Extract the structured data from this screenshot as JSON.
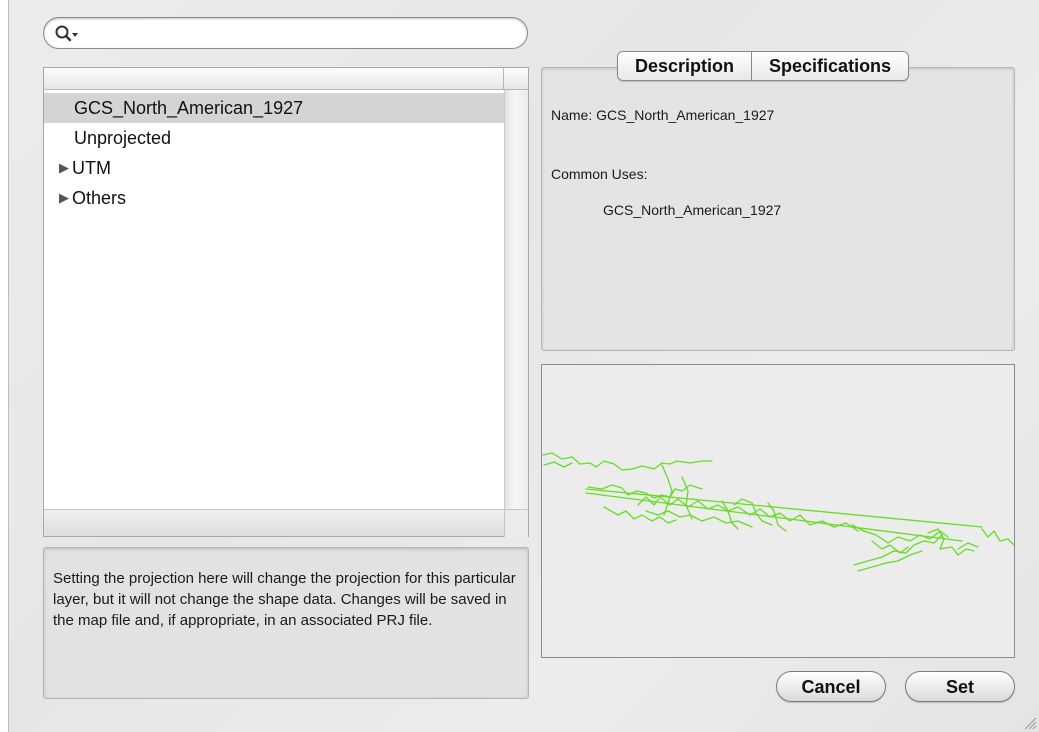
{
  "search": {
    "value": "",
    "placeholder": ""
  },
  "projection_list": {
    "items": [
      {
        "label": "GCS_North_American_1927",
        "selected": true,
        "expandable": false
      },
      {
        "label": "Unprojected",
        "selected": false,
        "expandable": false
      },
      {
        "label": "UTM",
        "selected": false,
        "expandable": true
      },
      {
        "label": "Others",
        "selected": false,
        "expandable": true
      }
    ]
  },
  "info_text": "Setting the projection here will change the projection for this particular layer, but it will not change the shape data.  Changes will be saved in the map file and, if appropriate, in an associated PRJ file.",
  "tabs": [
    {
      "label": "Description",
      "active": false
    },
    {
      "label": "Specifications",
      "active": false
    }
  ],
  "description": {
    "name_line": "Name: GCS_North_American_1927",
    "common_uses_label": "Common Uses:",
    "common_uses_value": "GCS_North_American_1927"
  },
  "map_preview": {
    "line_color": "#66dd22"
  },
  "buttons": {
    "cancel": "Cancel",
    "set": "Set"
  }
}
